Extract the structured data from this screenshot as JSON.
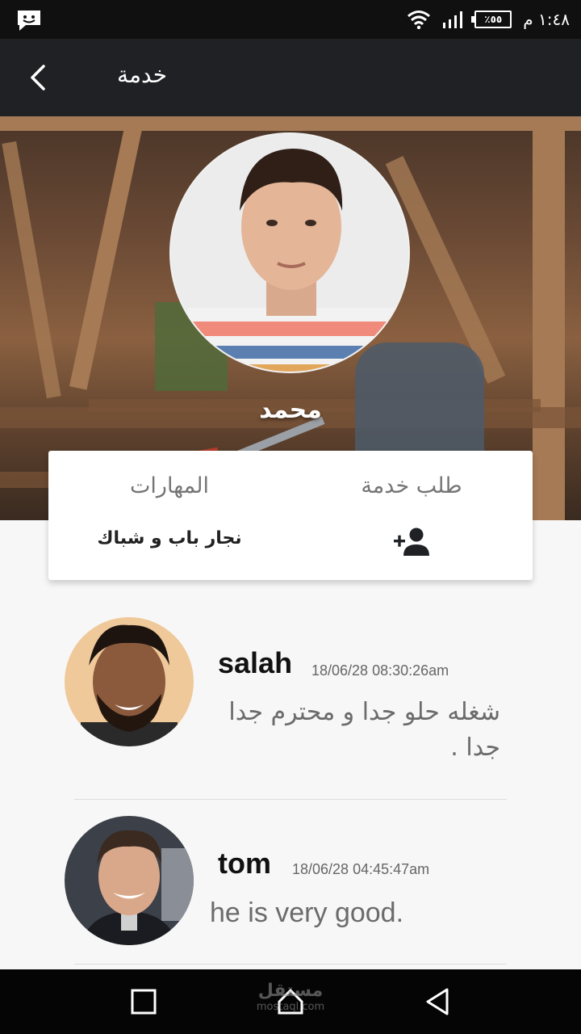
{
  "status_bar": {
    "time": "١:٤٨ م",
    "battery_label": "٪٥٥",
    "icons": [
      "message-icon",
      "wifi-icon",
      "signal-icon",
      "battery-icon"
    ]
  },
  "toolbar": {
    "title": "خدمة",
    "back_icon": "chevron-left-icon"
  },
  "profile": {
    "name": "محمد"
  },
  "card": {
    "request_label": "طلب خدمة",
    "skills_label": "المهارات",
    "skills_value": "نجار باب و شباك",
    "request_icon": "add-user-icon"
  },
  "reviews": [
    {
      "name": "salah",
      "date": "18/06/28  08:30:26am",
      "text": "شغله حلو جدا و محترم جدا جدا ."
    },
    {
      "name": "tom",
      "date": "18/06/28  04:45:47am",
      "text": "he is very good."
    }
  ],
  "nav_bar": {
    "watermark": "مستقل",
    "watermark_sub": "mostaql.com",
    "buttons": [
      "recent-apps-icon",
      "home-icon",
      "back-icon"
    ]
  },
  "colors": {
    "toolbar": "#1f2125",
    "status_bar": "#101010",
    "nav_bar": "#050505",
    "card": "#ffffff"
  }
}
